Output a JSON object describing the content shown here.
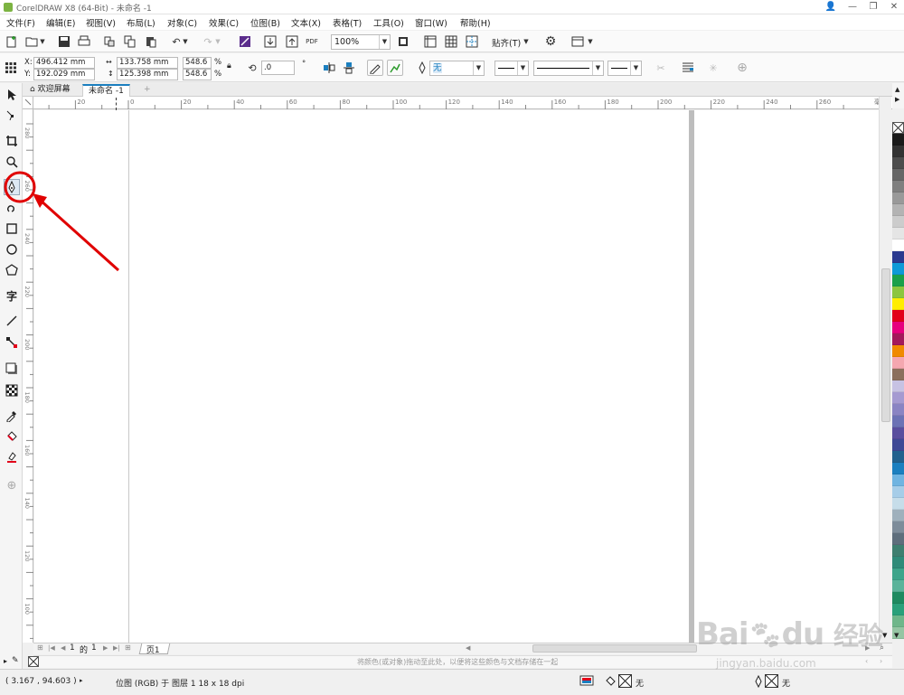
{
  "window": {
    "title": "CorelDRAW X8 (64-Bit) - 未命名 -1",
    "controls": [
      "👤",
      "—",
      "❐",
      "✕"
    ]
  },
  "menu": [
    "文件(F)",
    "编辑(E)",
    "视图(V)",
    "布局(L)",
    "对象(C)",
    "效果(C)",
    "位图(B)",
    "文本(X)",
    "表格(T)",
    "工具(O)",
    "窗口(W)",
    "帮助(H)"
  ],
  "toolbar": {
    "zoom": "100%",
    "snap": "贴齐(T)",
    "pdf": "PDF"
  },
  "propbar": {
    "x_label": "X:",
    "x_value": "496.412 mm",
    "y_label": "Y:",
    "y_value": "192.029 mm",
    "w_value": "133.758 mm",
    "h_value": "125.398 mm",
    "sx_value": "548.6",
    "sy_value": "548.6",
    "pct": "%",
    "rotation": ".0",
    "degree": "°",
    "fill_value": "无"
  },
  "tabs": {
    "welcome": "欢迎屏幕",
    "doc": "未命名 -1",
    "add": "+"
  },
  "ruler": {
    "h_labels": [
      "20",
      "0",
      "20",
      "40",
      "60",
      "80",
      "100",
      "120",
      "140",
      "160",
      "180",
      "200",
      "220",
      "240",
      "260"
    ],
    "unit": "毫米",
    "v_labels": [
      "280",
      "260",
      "240",
      "220",
      "200",
      "180",
      "160",
      "140",
      "120",
      "100"
    ]
  },
  "pagenav": {
    "current": "1",
    "of": "的",
    "total": "1",
    "page_tab": "页1"
  },
  "docpal_hint": "将颜色(或对象)拖动至此处，以便将这些颜色与文档存储在一起",
  "status": {
    "coords": "( 3.167 , 94.603 )",
    "object_info": "位图 (RGB) 于 图层 1 18 x 18 dpi",
    "fill_none": "无",
    "outline_none": "无"
  },
  "watermark": {
    "brand": "Bai",
    "brand2": "du",
    "cn": "经验",
    "url": "jingyan.baidu.com"
  },
  "palette_colors": [
    "#1b1b1b",
    "#333333",
    "#4d4d4d",
    "#666666",
    "#7f7f7f",
    "#999999",
    "#b3b3b3",
    "#cccccc",
    "#e5e5e5",
    "#ffffff",
    "#2b3a8f",
    "#0e9ad7",
    "#1aa04a",
    "#8cc63f",
    "#ffed00",
    "#e2001a",
    "#e6007e",
    "#a3195b",
    "#f08a00",
    "#f4a7b0",
    "#8b6f5c",
    "#c7c2e3",
    "#a59ad1",
    "#8a84c3",
    "#6c72b5",
    "#5a4e9e",
    "#3f4996",
    "#22618e",
    "#1b7fbf",
    "#6fb4e1",
    "#a6cde8",
    "#c6dde9",
    "#9fb0bc",
    "#7d8c9a",
    "#5e6e7c",
    "#3e7f70",
    "#2f8b79",
    "#3da48a",
    "#5bb39a",
    "#1e8a60",
    "#2aa07a",
    "#6fb68a",
    "#95c5a3"
  ],
  "colors": {
    "accent": "#e00000",
    "selection": "#0078d7"
  }
}
